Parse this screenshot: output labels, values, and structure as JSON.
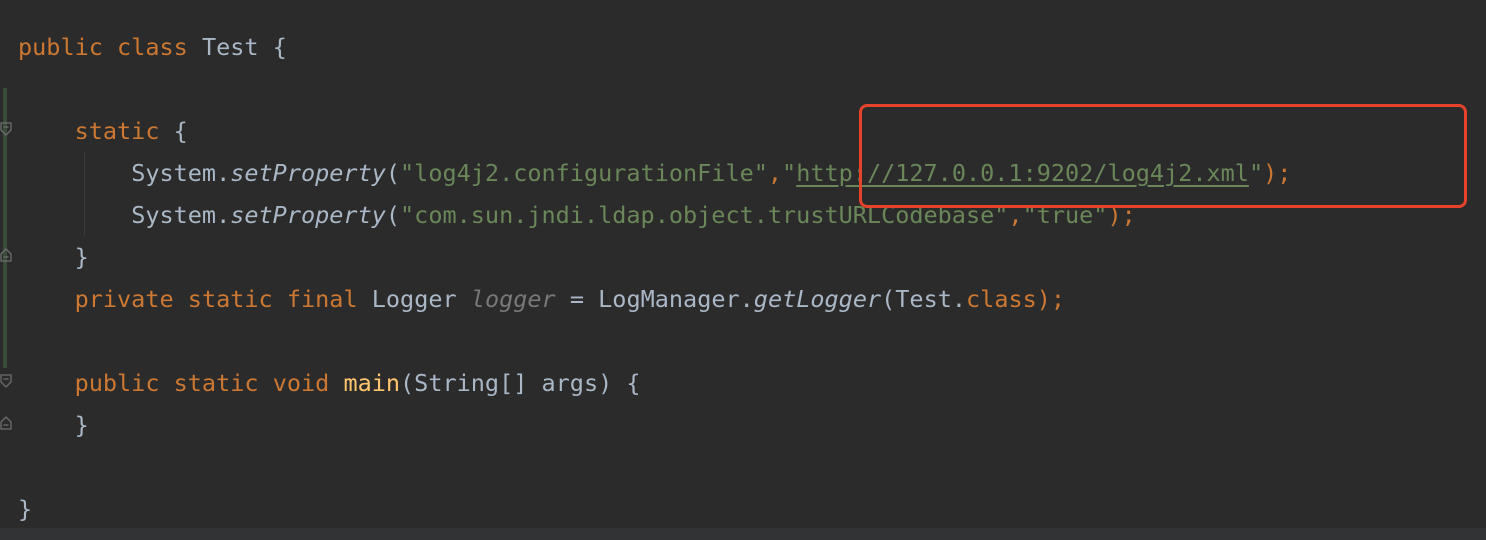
{
  "code": {
    "line1": {
      "kw_public": "public",
      "kw_class": "class",
      "name": "Test",
      "brace": "{"
    },
    "line2": {
      "kw_static": "static",
      "brace": "{"
    },
    "line3": {
      "obj": "System.",
      "method": "setProperty",
      "paren_open": "(",
      "arg1": "\"log4j2.configurationFile\"",
      "comma": ",",
      "q_open": "\"",
      "url": "http://127.0.0.1:9202/log4j2.xml",
      "q_close": "\"",
      "end": ");"
    },
    "line4": {
      "obj": "System.",
      "method": "setProperty",
      "paren_open": "(",
      "arg1": "\"com.sun.jndi.ldap.object.trustURLCodebase\"",
      "comma": ",",
      "arg2": "\"true\"",
      "end": ");"
    },
    "line5": {
      "brace": "}"
    },
    "line6": {
      "kw_private": "private",
      "kw_static": "static",
      "kw_final": "final",
      "type": "Logger",
      "field": "logger",
      "assign": "=",
      "call_obj": "LogManager.",
      "call_method": "getLogger",
      "arg_open": "(Test.",
      "kw_class": "class",
      "end": ");"
    },
    "line7": {
      "kw_public": "public",
      "kw_static": "static",
      "kw_void": "void",
      "method": "main",
      "params": "(String[] args)",
      "brace": "{"
    },
    "line8": {
      "brace": "}"
    },
    "line9": {
      "brace": "}"
    }
  },
  "colors": {
    "background": "#2b2b2b",
    "keyword": "#cc7832",
    "string": "#6a8759",
    "identifier": "#a9b7c6",
    "method_declaration": "#ffc66d",
    "field": "#787878",
    "highlight_box": "#e5432b"
  }
}
